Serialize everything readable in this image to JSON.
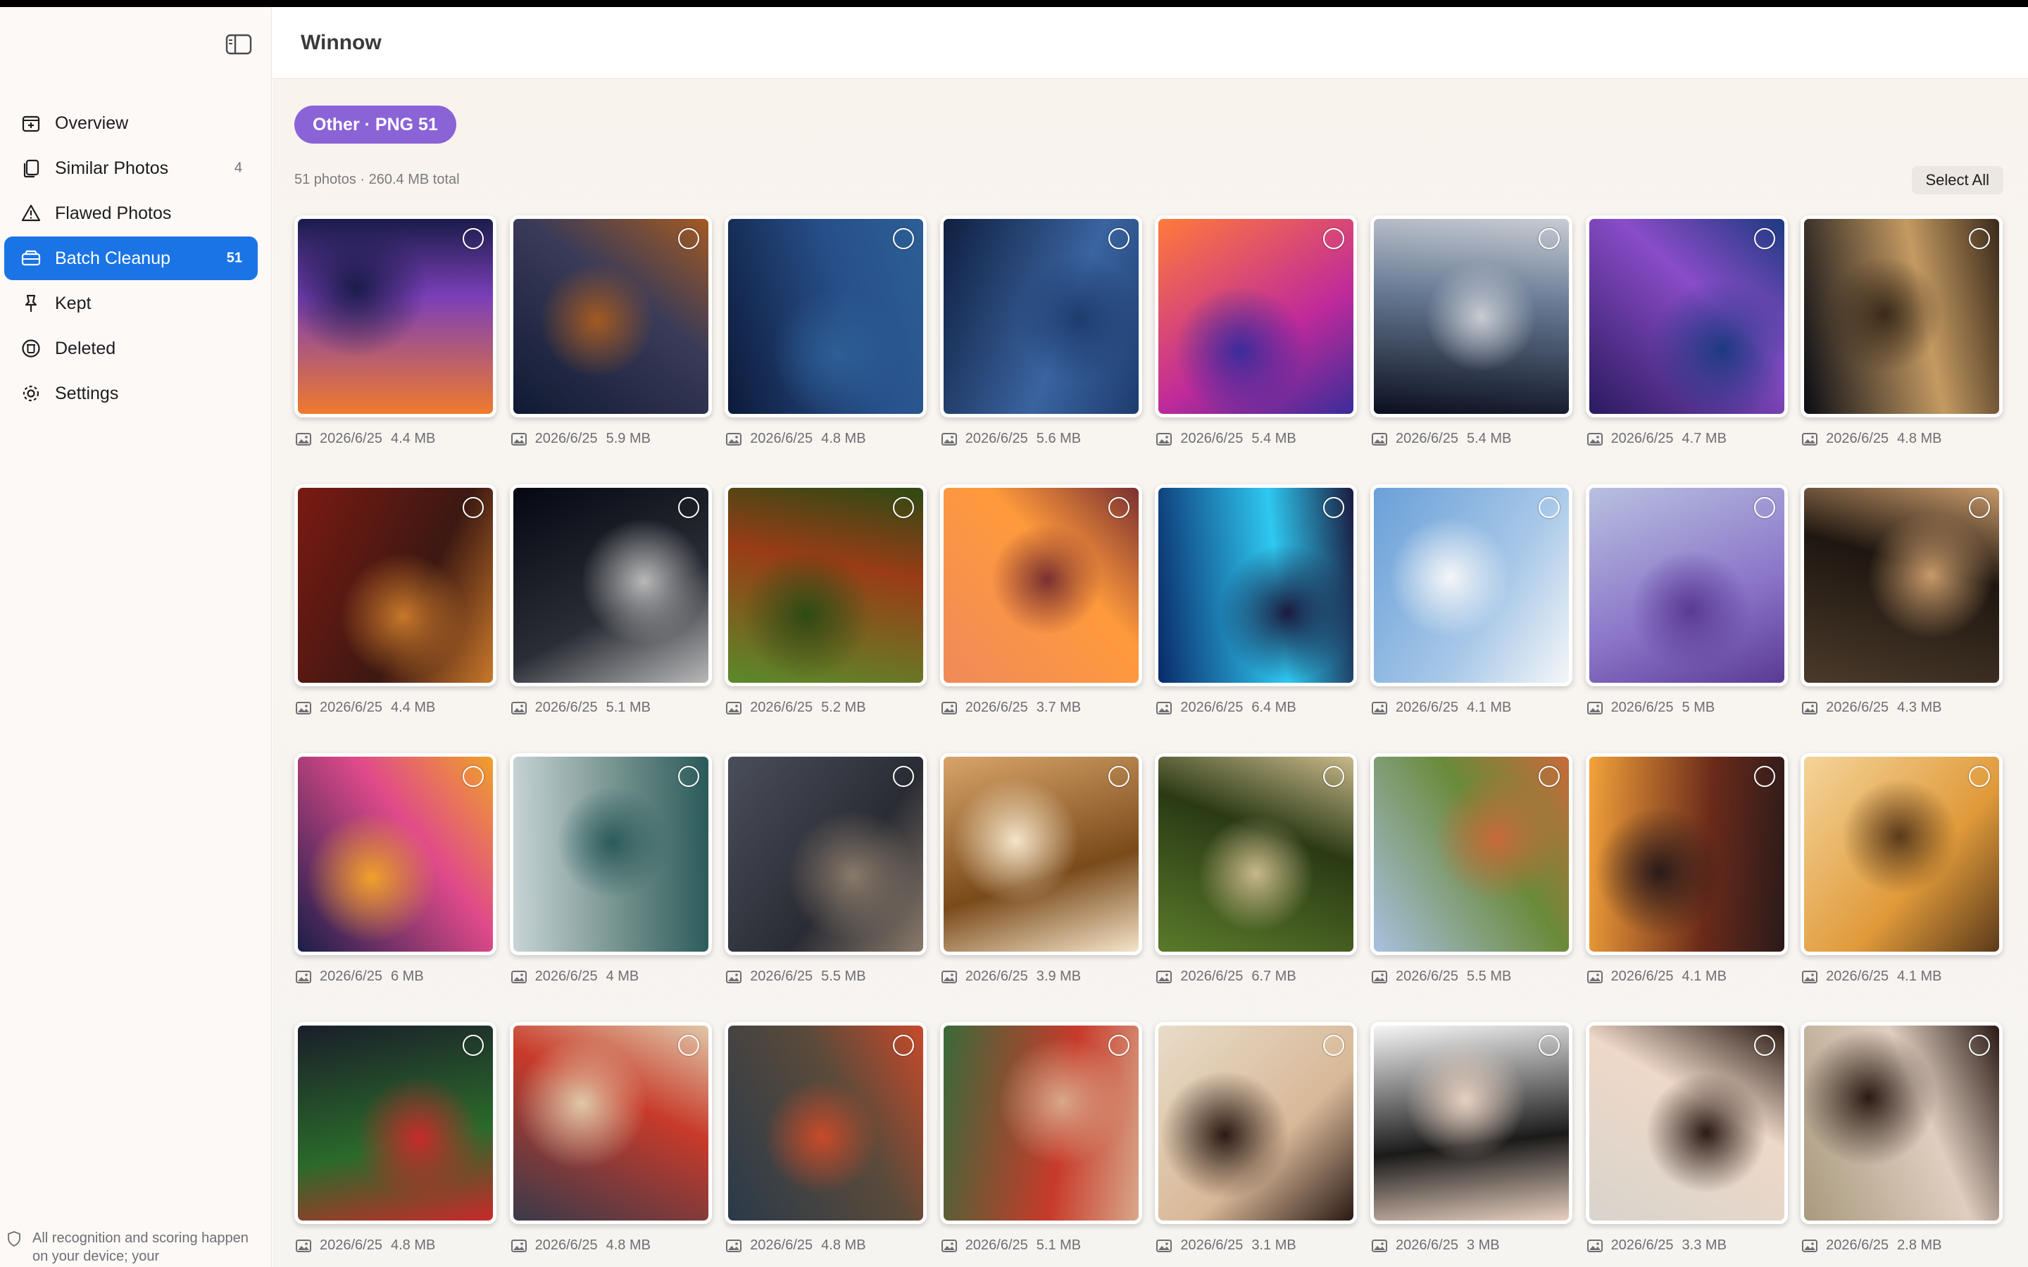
{
  "app": {
    "title": "Winnow"
  },
  "sidebar": {
    "items": [
      {
        "label": "Overview",
        "count": "",
        "icon": "overview-icon"
      },
      {
        "label": "Similar Photos",
        "count": "4",
        "icon": "similar-photos-icon"
      },
      {
        "label": "Flawed Photos",
        "count": "",
        "icon": "warning-icon"
      },
      {
        "label": "Batch Cleanup",
        "count": "51",
        "icon": "batch-cleanup-icon",
        "active": true
      },
      {
        "label": "Kept",
        "count": "",
        "icon": "pin-icon"
      },
      {
        "label": "Deleted",
        "count": "",
        "icon": "trash-circle-icon"
      },
      {
        "label": "Settings",
        "count": "",
        "icon": "gear-icon"
      }
    ],
    "privacy_note": "All recognition and scoring happen on your device; your"
  },
  "main": {
    "filter_chip": "Other · PNG 51",
    "summary": "51 photos · 260.4 MB total",
    "select_all_label": "Select All"
  },
  "colors": {
    "accent": "#1a74e6",
    "chip": "#8a63d6"
  },
  "photos": [
    {
      "date": "2026/6/25",
      "size": "4.4 MB",
      "art": [
        "#f07a2c",
        "#7b3fb8",
        "#1a1c4a"
      ]
    },
    {
      "date": "2026/6/25",
      "size": "5.9 MB",
      "art": [
        "#101a33",
        "#3a3b58",
        "#a35a22"
      ]
    },
    {
      "date": "2026/6/25",
      "size": "4.8 MB",
      "art": [
        "#0d1a3a",
        "#27508a",
        "#2d5e95"
      ]
    },
    {
      "date": "2026/6/25",
      "size": "5.6 MB",
      "art": [
        "#0f1f40",
        "#3a64a0",
        "#1d3c6e"
      ]
    },
    {
      "date": "2026/6/25",
      "size": "5.4 MB",
      "art": [
        "#ff7a3a",
        "#c02a9a",
        "#3a2c9a"
      ]
    },
    {
      "date": "2026/6/25",
      "size": "5.4 MB",
      "art": [
        "#0a0f1e",
        "#6a7c96",
        "#c8ccd2"
      ]
    },
    {
      "date": "2026/6/25",
      "size": "4.7 MB",
      "art": [
        "#2a1a5e",
        "#8a4cc8",
        "#1d3a80"
      ]
    },
    {
      "date": "2026/6/25",
      "size": "4.8 MB",
      "art": [
        "#0a0c14",
        "#c49a62",
        "#3a2a1a"
      ]
    },
    {
      "date": "2026/6/25",
      "size": "4.4 MB",
      "art": [
        "#7a1a12",
        "#3c1812",
        "#c8782a"
      ]
    },
    {
      "date": "2026/6/25",
      "size": "5.1 MB",
      "art": [
        "#050812",
        "#2a2d35",
        "#b8b8b8"
      ]
    },
    {
      "date": "2026/6/25",
      "size": "5.2 MB",
      "art": [
        "#5a8a2a",
        "#9a3c16",
        "#2e4a14"
      ]
    },
    {
      "date": "2026/6/25",
      "size": "3.7 MB",
      "art": [
        "#f08a5a",
        "#ff9a3c",
        "#7a3030"
      ]
    },
    {
      "date": "2026/6/25",
      "size": "6.4 MB",
      "art": [
        "#0a2a6a",
        "#2ec8f0",
        "#1a1a3e"
      ]
    },
    {
      "date": "2026/6/25",
      "size": "4.1 MB",
      "art": [
        "#6aa0d8",
        "#a8c8e8",
        "#f4f6f8"
      ]
    },
    {
      "date": "2026/6/25",
      "size": "5 MB",
      "art": [
        "#b8c0e0",
        "#8a74c8",
        "#5a3a94"
      ]
    },
    {
      "date": "2026/6/25",
      "size": "4.3 MB",
      "art": [
        "#4a3a2a",
        "#1e1610",
        "#c89a6a"
      ]
    },
    {
      "date": "2026/6/25",
      "size": "6 MB",
      "art": [
        "#1a1e4a",
        "#e04a8a",
        "#f0a02a"
      ]
    },
    {
      "date": "2026/6/25",
      "size": "4 MB",
      "art": [
        "#c8d4d6",
        "#6a8a86",
        "#2a5a5a"
      ]
    },
    {
      "date": "2026/6/25",
      "size": "5.5 MB",
      "art": [
        "#4a4e5a",
        "#2a2c34",
        "#8a7a6a"
      ]
    },
    {
      "date": "2026/6/25",
      "size": "3.9 MB",
      "art": [
        "#d8a46a",
        "#7a4a1a",
        "#f4e4c8"
      ]
    },
    {
      "date": "2026/6/25",
      "size": "6.7 MB",
      "art": [
        "#5a7a2a",
        "#2a3a14",
        "#c8b88a"
      ]
    },
    {
      "date": "2026/6/25",
      "size": "5.5 MB",
      "art": [
        "#a8c0e0",
        "#6a8a3a",
        "#c86a3a"
      ]
    },
    {
      "date": "2026/6/25",
      "size": "4.1 MB",
      "art": [
        "#f4a23a",
        "#6a2a1a",
        "#2a1a1a"
      ]
    },
    {
      "date": "2026/6/25",
      "size": "4.1 MB",
      "art": [
        "#f4d49a",
        "#e09a3a",
        "#5a3a1a"
      ]
    },
    {
      "date": "2026/6/25",
      "size": "4.8 MB",
      "art": [
        "#1a1e2a",
        "#2a6a2a",
        "#c82a2a"
      ]
    },
    {
      "date": "2026/6/25",
      "size": "4.8 MB",
      "art": [
        "#3a3a4a",
        "#c83a2a",
        "#e0c8a8"
      ]
    },
    {
      "date": "2026/6/25",
      "size": "4.8 MB",
      "art": [
        "#2a3a4a",
        "#5a4a3a",
        "#c84a2a"
      ]
    },
    {
      "date": "2026/6/25",
      "size": "5.1 MB",
      "art": [
        "#3a6a3a",
        "#c83a2a",
        "#d8a88a"
      ]
    },
    {
      "date": "2026/6/25",
      "size": "3.1 MB",
      "art": [
        "#e8dcc8",
        "#d8b898",
        "#2a1a14"
      ]
    },
    {
      "date": "2026/6/25",
      "size": "3 MB",
      "art": [
        "#f6f6f6",
        "#1a1a1a",
        "#e8d0c0"
      ]
    },
    {
      "date": "2026/6/25",
      "size": "3.3 MB",
      "art": [
        "#d8d4cc",
        "#eed8c8",
        "#2a1a14"
      ]
    },
    {
      "date": "2026/6/25",
      "size": "2.8 MB",
      "art": [
        "#a89a7e",
        "#e0cec0",
        "#2a1a14"
      ]
    }
  ]
}
